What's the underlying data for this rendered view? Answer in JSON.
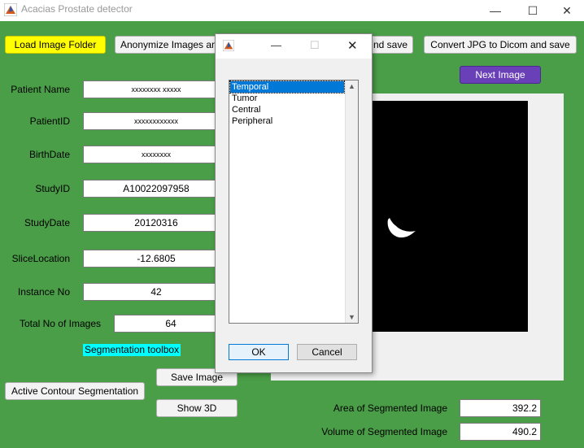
{
  "window": {
    "title": "Acacias Prostate detector",
    "minimize": "—",
    "maximize": "☐",
    "close": "✕"
  },
  "toolbar": {
    "load_folder": "Load Image Folder",
    "anonymize": "Anonymize Images an",
    "partial_save": "nd save",
    "convert": "Convert JPG to Dicom and save",
    "next_image": "Next Image"
  },
  "form": [
    {
      "label": "Patient Name",
      "value": "xxxxxxxx xxxxx"
    },
    {
      "label": "PatientID",
      "value": "xxxxxxxxxxxx"
    },
    {
      "label": "BirthDate",
      "value": "xxxxxxxx"
    },
    {
      "label": "StudyID",
      "value": "A10022097958"
    },
    {
      "label": "StudyDate",
      "value": "20120316"
    },
    {
      "label": "SliceLocation",
      "value": "-12.6805"
    },
    {
      "label": "Instance No",
      "value": "42"
    },
    {
      "label": "Total No of Images",
      "value": "64"
    }
  ],
  "segmentation": {
    "toolbox_label": "Segmentation toolbox",
    "active_contour": "Active Contour Segmentation",
    "save_image": "Save Image",
    "show_3d": "Show 3D"
  },
  "results": {
    "area_label": "Area of Segmented Image",
    "area_value": "392.2",
    "volume_label": "Volume of Segmented Image",
    "volume_value": "490.2"
  },
  "dialog": {
    "minimize": "—",
    "maximize": "☐",
    "close": "✕",
    "options": [
      "Temporal",
      "Tumor",
      "Central",
      "Peripheral"
    ],
    "selected": "Temporal",
    "ok": "OK",
    "cancel": "Cancel"
  },
  "colors": {
    "background": "#4a9e47",
    "load_button": "#ffff00",
    "next_button": "#6a40b8",
    "toolbox_label": "#00ffff"
  }
}
